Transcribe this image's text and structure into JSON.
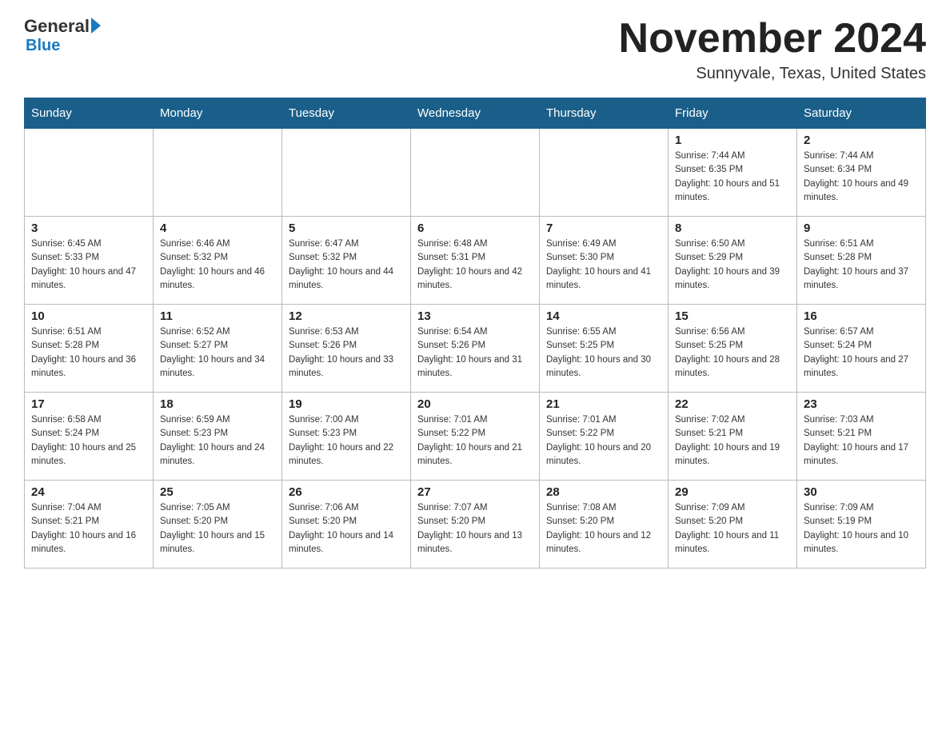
{
  "logo": {
    "general": "General",
    "blue": "Blue"
  },
  "header": {
    "month": "November 2024",
    "location": "Sunnyvale, Texas, United States"
  },
  "weekdays": [
    "Sunday",
    "Monday",
    "Tuesday",
    "Wednesday",
    "Thursday",
    "Friday",
    "Saturday"
  ],
  "weeks": [
    [
      {
        "day": "",
        "sunrise": "",
        "sunset": "",
        "daylight": ""
      },
      {
        "day": "",
        "sunrise": "",
        "sunset": "",
        "daylight": ""
      },
      {
        "day": "",
        "sunrise": "",
        "sunset": "",
        "daylight": ""
      },
      {
        "day": "",
        "sunrise": "",
        "sunset": "",
        "daylight": ""
      },
      {
        "day": "",
        "sunrise": "",
        "sunset": "",
        "daylight": ""
      },
      {
        "day": "1",
        "sunrise": "Sunrise: 7:44 AM",
        "sunset": "Sunset: 6:35 PM",
        "daylight": "Daylight: 10 hours and 51 minutes."
      },
      {
        "day": "2",
        "sunrise": "Sunrise: 7:44 AM",
        "sunset": "Sunset: 6:34 PM",
        "daylight": "Daylight: 10 hours and 49 minutes."
      }
    ],
    [
      {
        "day": "3",
        "sunrise": "Sunrise: 6:45 AM",
        "sunset": "Sunset: 5:33 PM",
        "daylight": "Daylight: 10 hours and 47 minutes."
      },
      {
        "day": "4",
        "sunrise": "Sunrise: 6:46 AM",
        "sunset": "Sunset: 5:32 PM",
        "daylight": "Daylight: 10 hours and 46 minutes."
      },
      {
        "day": "5",
        "sunrise": "Sunrise: 6:47 AM",
        "sunset": "Sunset: 5:32 PM",
        "daylight": "Daylight: 10 hours and 44 minutes."
      },
      {
        "day": "6",
        "sunrise": "Sunrise: 6:48 AM",
        "sunset": "Sunset: 5:31 PM",
        "daylight": "Daylight: 10 hours and 42 minutes."
      },
      {
        "day": "7",
        "sunrise": "Sunrise: 6:49 AM",
        "sunset": "Sunset: 5:30 PM",
        "daylight": "Daylight: 10 hours and 41 minutes."
      },
      {
        "day": "8",
        "sunrise": "Sunrise: 6:50 AM",
        "sunset": "Sunset: 5:29 PM",
        "daylight": "Daylight: 10 hours and 39 minutes."
      },
      {
        "day": "9",
        "sunrise": "Sunrise: 6:51 AM",
        "sunset": "Sunset: 5:28 PM",
        "daylight": "Daylight: 10 hours and 37 minutes."
      }
    ],
    [
      {
        "day": "10",
        "sunrise": "Sunrise: 6:51 AM",
        "sunset": "Sunset: 5:28 PM",
        "daylight": "Daylight: 10 hours and 36 minutes."
      },
      {
        "day": "11",
        "sunrise": "Sunrise: 6:52 AM",
        "sunset": "Sunset: 5:27 PM",
        "daylight": "Daylight: 10 hours and 34 minutes."
      },
      {
        "day": "12",
        "sunrise": "Sunrise: 6:53 AM",
        "sunset": "Sunset: 5:26 PM",
        "daylight": "Daylight: 10 hours and 33 minutes."
      },
      {
        "day": "13",
        "sunrise": "Sunrise: 6:54 AM",
        "sunset": "Sunset: 5:26 PM",
        "daylight": "Daylight: 10 hours and 31 minutes."
      },
      {
        "day": "14",
        "sunrise": "Sunrise: 6:55 AM",
        "sunset": "Sunset: 5:25 PM",
        "daylight": "Daylight: 10 hours and 30 minutes."
      },
      {
        "day": "15",
        "sunrise": "Sunrise: 6:56 AM",
        "sunset": "Sunset: 5:25 PM",
        "daylight": "Daylight: 10 hours and 28 minutes."
      },
      {
        "day": "16",
        "sunrise": "Sunrise: 6:57 AM",
        "sunset": "Sunset: 5:24 PM",
        "daylight": "Daylight: 10 hours and 27 minutes."
      }
    ],
    [
      {
        "day": "17",
        "sunrise": "Sunrise: 6:58 AM",
        "sunset": "Sunset: 5:24 PM",
        "daylight": "Daylight: 10 hours and 25 minutes."
      },
      {
        "day": "18",
        "sunrise": "Sunrise: 6:59 AM",
        "sunset": "Sunset: 5:23 PM",
        "daylight": "Daylight: 10 hours and 24 minutes."
      },
      {
        "day": "19",
        "sunrise": "Sunrise: 7:00 AM",
        "sunset": "Sunset: 5:23 PM",
        "daylight": "Daylight: 10 hours and 22 minutes."
      },
      {
        "day": "20",
        "sunrise": "Sunrise: 7:01 AM",
        "sunset": "Sunset: 5:22 PM",
        "daylight": "Daylight: 10 hours and 21 minutes."
      },
      {
        "day": "21",
        "sunrise": "Sunrise: 7:01 AM",
        "sunset": "Sunset: 5:22 PM",
        "daylight": "Daylight: 10 hours and 20 minutes."
      },
      {
        "day": "22",
        "sunrise": "Sunrise: 7:02 AM",
        "sunset": "Sunset: 5:21 PM",
        "daylight": "Daylight: 10 hours and 19 minutes."
      },
      {
        "day": "23",
        "sunrise": "Sunrise: 7:03 AM",
        "sunset": "Sunset: 5:21 PM",
        "daylight": "Daylight: 10 hours and 17 minutes."
      }
    ],
    [
      {
        "day": "24",
        "sunrise": "Sunrise: 7:04 AM",
        "sunset": "Sunset: 5:21 PM",
        "daylight": "Daylight: 10 hours and 16 minutes."
      },
      {
        "day": "25",
        "sunrise": "Sunrise: 7:05 AM",
        "sunset": "Sunset: 5:20 PM",
        "daylight": "Daylight: 10 hours and 15 minutes."
      },
      {
        "day": "26",
        "sunrise": "Sunrise: 7:06 AM",
        "sunset": "Sunset: 5:20 PM",
        "daylight": "Daylight: 10 hours and 14 minutes."
      },
      {
        "day": "27",
        "sunrise": "Sunrise: 7:07 AM",
        "sunset": "Sunset: 5:20 PM",
        "daylight": "Daylight: 10 hours and 13 minutes."
      },
      {
        "day": "28",
        "sunrise": "Sunrise: 7:08 AM",
        "sunset": "Sunset: 5:20 PM",
        "daylight": "Daylight: 10 hours and 12 minutes."
      },
      {
        "day": "29",
        "sunrise": "Sunrise: 7:09 AM",
        "sunset": "Sunset: 5:20 PM",
        "daylight": "Daylight: 10 hours and 11 minutes."
      },
      {
        "day": "30",
        "sunrise": "Sunrise: 7:09 AM",
        "sunset": "Sunset: 5:19 PM",
        "daylight": "Daylight: 10 hours and 10 minutes."
      }
    ]
  ]
}
